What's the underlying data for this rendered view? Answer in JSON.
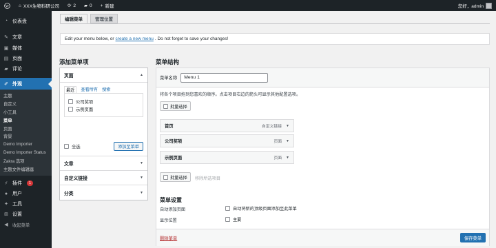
{
  "adminbar": {
    "site_name": "XXX生物科研公司",
    "updates_count": "2",
    "comments_count": "0",
    "new_label": "新建",
    "greeting": "您好，admin"
  },
  "sidebar": {
    "dashboard": "仪表盘",
    "posts": "文章",
    "media": "媒体",
    "pages": "页面",
    "comments": "评论",
    "appearance": "外观",
    "sub": [
      "主题",
      "自定义",
      "小工具",
      "菜单",
      "页面",
      "背景",
      "Demo Importer",
      "Demo Importer Status",
      "Zakra 选项",
      "主题文件编辑器"
    ],
    "plugins": "插件",
    "plugins_badge": "1",
    "users": "用户",
    "tools": "工具",
    "settings": "设置",
    "collapse": "收起菜单"
  },
  "tabs": {
    "edit": "编辑菜单",
    "locations": "管理位置"
  },
  "notice": {
    "before": "Edit your menu below, or",
    "link": "create a new menu",
    "after": ". Do not forget to save your changes!"
  },
  "add_items": {
    "heading": "添加菜单项",
    "pages_section": "页面",
    "subtabs": [
      "最近",
      "查看所有",
      "搜索"
    ],
    "pages": [
      "公司奖项",
      "示例页面"
    ],
    "select_all": "全选",
    "add_button": "添加至菜单",
    "sections": [
      "文章",
      "自定义链接",
      "分类"
    ]
  },
  "structure": {
    "heading": "菜单结构",
    "name_label": "菜单名称",
    "name_value": "Menu 1",
    "instructions": "将各个项目拖到您喜欢的顺序。点击项目右边的箭头可显示其他配置选项。",
    "bulk_select": "批量选择",
    "remove_selected": "移除所选项目",
    "items": [
      {
        "title": "首页",
        "type": "自定义链接"
      },
      {
        "title": "公司奖项",
        "type": "页面"
      },
      {
        "title": "示例页面",
        "type": "页面"
      }
    ],
    "settings_heading": "菜单设置",
    "auto_add_label": "自动添加页面",
    "auto_add_option": "自动将新的顶级页面添加至此菜单",
    "display_label": "显示位置",
    "display_option": "主要",
    "delete_link": "删除菜单",
    "save_button": "保存菜单"
  }
}
